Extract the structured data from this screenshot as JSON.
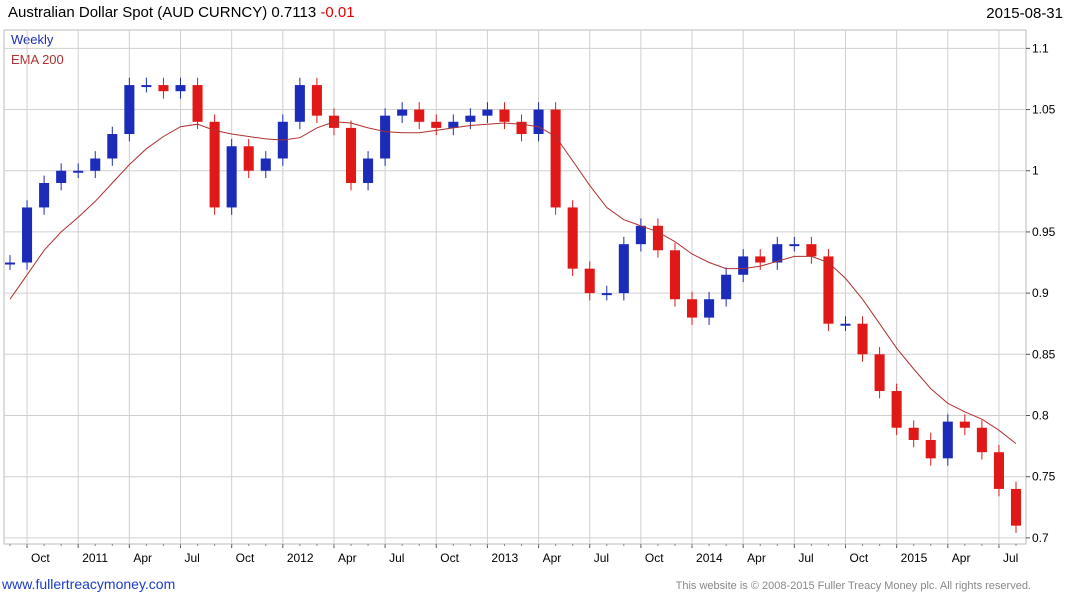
{
  "header": {
    "title": "Australian Dollar Spot (AUD CURNCY) 0.7113",
    "change": "-0.01",
    "date": "2015-08-31"
  },
  "legend": {
    "weekly": "Weekly",
    "ema": "EMA 200"
  },
  "footer": {
    "url": "www.fullertreacymoney.com",
    "copyright": "This website is © 2008-2015 Fuller Treacy Money plc. All rights reserved."
  },
  "colors": {
    "up": "#1c2cb8",
    "down": "#e01818",
    "ema": "#b03030",
    "grid": "#d0d0d0"
  },
  "chart_data": {
    "type": "line",
    "title": "Australian Dollar Spot (AUD CURNCY) 0.7113 -0.01",
    "xlabel": "",
    "ylabel": "",
    "ylim": [
      0.695,
      1.115
    ],
    "y_ticks": [
      1.1,
      1.05,
      1,
      0.95,
      0.9,
      0.85,
      0.8,
      0.75,
      0.7
    ],
    "x_ticks": [
      "Oct",
      "2011",
      "Apr",
      "Jul",
      "Oct",
      "2012",
      "Apr",
      "Jul",
      "Oct",
      "2013",
      "Apr",
      "Jul",
      "Oct",
      "2014",
      "Apr",
      "Jul",
      "Oct",
      "2015",
      "Apr",
      "Jul"
    ],
    "grid": true,
    "legend_position": "top-left",
    "series": [
      {
        "name": "EMA 200",
        "x": [
          "2010-09",
          "2010-10",
          "2010-11",
          "2010-12",
          "2011-01",
          "2011-02",
          "2011-03",
          "2011-04",
          "2011-05",
          "2011-06",
          "2011-07",
          "2011-08",
          "2011-09",
          "2011-10",
          "2011-11",
          "2011-12",
          "2012-01",
          "2012-02",
          "2012-03",
          "2012-04",
          "2012-05",
          "2012-06",
          "2012-07",
          "2012-08",
          "2012-09",
          "2012-10",
          "2012-11",
          "2012-12",
          "2013-01",
          "2013-02",
          "2013-03",
          "2013-04",
          "2013-05",
          "2013-06",
          "2013-07",
          "2013-08",
          "2013-09",
          "2013-10",
          "2013-11",
          "2013-12",
          "2014-01",
          "2014-02",
          "2014-03",
          "2014-04",
          "2014-05",
          "2014-06",
          "2014-07",
          "2014-08",
          "2014-09",
          "2014-10",
          "2014-11",
          "2014-12",
          "2015-01",
          "2015-02",
          "2015-03",
          "2015-04",
          "2015-05",
          "2015-06",
          "2015-07",
          "2015-08"
        ],
        "values": [
          0.895,
          0.915,
          0.935,
          0.95,
          0.962,
          0.975,
          0.99,
          1.005,
          1.018,
          1.028,
          1.036,
          1.038,
          1.033,
          1.03,
          1.028,
          1.026,
          1.025,
          1.027,
          1.035,
          1.04,
          1.039,
          1.035,
          1.032,
          1.031,
          1.031,
          1.033,
          1.035,
          1.037,
          1.038,
          1.039,
          1.038,
          1.036,
          1.028,
          1.008,
          0.988,
          0.97,
          0.96,
          0.955,
          0.95,
          0.942,
          0.932,
          0.925,
          0.92,
          0.92,
          0.922,
          0.926,
          0.93,
          0.93,
          0.925,
          0.912,
          0.895,
          0.875,
          0.855,
          0.838,
          0.822,
          0.81,
          0.803,
          0.797,
          0.788,
          0.777
        ]
      },
      {
        "name": "Weekly",
        "x": [
          "2010-09",
          "2010-10",
          "2010-11",
          "2010-12",
          "2011-01",
          "2011-02",
          "2011-03",
          "2011-04",
          "2011-05",
          "2011-06",
          "2011-07",
          "2011-08",
          "2011-09",
          "2011-10",
          "2011-11",
          "2011-12",
          "2012-01",
          "2012-02",
          "2012-03",
          "2012-04",
          "2012-05",
          "2012-06",
          "2012-07",
          "2012-08",
          "2012-09",
          "2012-10",
          "2012-11",
          "2012-12",
          "2013-01",
          "2013-02",
          "2013-03",
          "2013-04",
          "2013-05",
          "2013-06",
          "2013-07",
          "2013-08",
          "2013-09",
          "2013-10",
          "2013-11",
          "2013-12",
          "2014-01",
          "2014-02",
          "2014-03",
          "2014-04",
          "2014-05",
          "2014-06",
          "2014-07",
          "2014-08",
          "2014-09",
          "2014-10",
          "2014-11",
          "2014-12",
          "2015-01",
          "2015-02",
          "2015-03",
          "2015-04",
          "2015-05",
          "2015-06",
          "2015-07",
          "2015-08"
        ],
        "values": [
          0.925,
          0.97,
          0.99,
          1.0,
          1.0,
          1.01,
          1.03,
          1.07,
          1.07,
          1.065,
          1.07,
          1.04,
          0.97,
          1.02,
          1.0,
          1.01,
          1.04,
          1.07,
          1.045,
          1.035,
          0.99,
          1.01,
          1.045,
          1.05,
          1.04,
          1.035,
          1.04,
          1.045,
          1.05,
          1.04,
          1.03,
          1.05,
          0.97,
          0.92,
          0.9,
          0.9,
          0.94,
          0.955,
          0.935,
          0.895,
          0.88,
          0.895,
          0.915,
          0.93,
          0.925,
          0.94,
          0.94,
          0.93,
          0.875,
          0.875,
          0.85,
          0.82,
          0.79,
          0.78,
          0.765,
          0.795,
          0.79,
          0.77,
          0.74,
          0.71
        ]
      }
    ]
  }
}
